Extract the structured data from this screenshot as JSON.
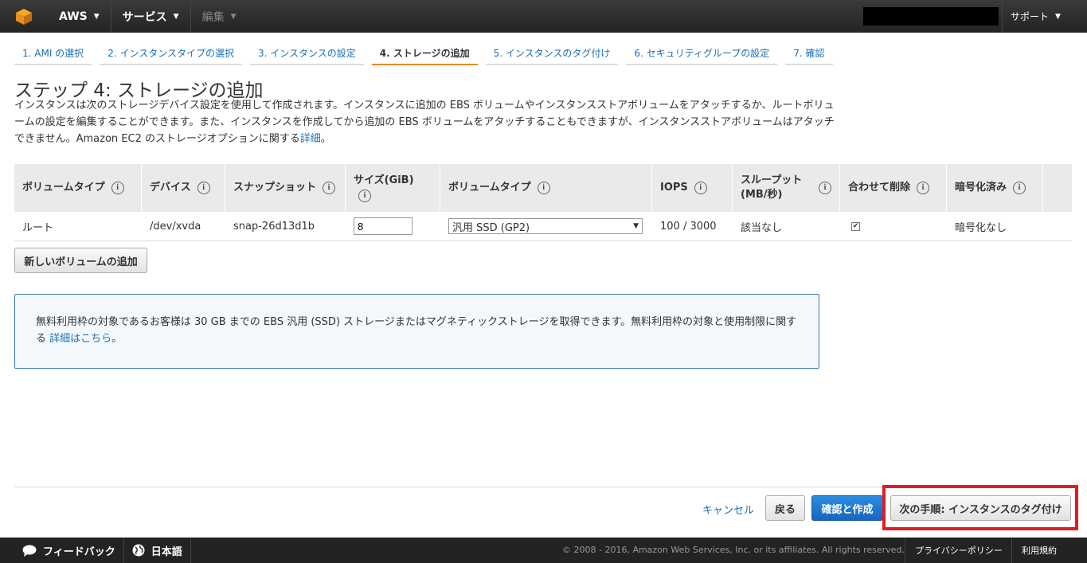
{
  "topnav": {
    "logo_icon": "aws-cube-icon",
    "aws_label": "AWS",
    "services_label": "サービス",
    "edit_label": "編集",
    "support_label": "サポート"
  },
  "wizard": {
    "tabs": [
      {
        "label": "1. AMI の選択",
        "active": false
      },
      {
        "label": "2. インスタンスタイプの選択",
        "active": false
      },
      {
        "label": "3. インスタンスの設定",
        "active": false
      },
      {
        "label": "4. ストレージの追加",
        "active": true
      },
      {
        "label": "5. インスタンスのタグ付け",
        "active": false
      },
      {
        "label": "6. セキュリティグループの設定",
        "active": false
      },
      {
        "label": "7. 確認",
        "active": false
      }
    ]
  },
  "page": {
    "title": "ステップ 4: ストレージの追加",
    "description": "インスタンスは次のストレージデバイス設定を使用して作成されます。インスタンスに追加の EBS ボリュームやインスタンスストアボリュームをアタッチするか、ルートボリュームの設定を編集することができます。また、インスタンスを作成してから追加の EBS ボリュームをアタッチすることもできますが、インスタンスストアボリュームはアタッチできません。Amazon EC2 のストレージオプションに関する",
    "description_link": "詳細",
    "description_end": "。"
  },
  "table": {
    "headers": {
      "volume_type": "ボリュームタイプ",
      "device": "デバイス",
      "snapshot": "スナップショット",
      "size": "サイズ(GiB)",
      "ebs_type": "ボリュームタイプ",
      "iops": "IOPS",
      "throughput": "スループット (MB/秒)",
      "delete": "合わせて削除",
      "encrypted": "暗号化済み"
    },
    "row": {
      "volume_type": "ルート",
      "device": "/dev/xvda",
      "snapshot": "snap-26d13d1b",
      "size": "8",
      "ebs_type": "汎用 SSD (GP2)",
      "iops": "100 / 3000",
      "throughput": "該当なし",
      "delete_checked": true,
      "encrypted": "暗号化なし"
    }
  },
  "add_volume_label": "新しいボリュームの追加",
  "notice": {
    "text": "無料利用枠の対象であるお客様は 30 GB までの EBS 汎用 (SSD) ストレージまたはマグネティックストレージを取得できます。無料利用枠の対象と使用制限に関する",
    "link": "詳細はこちら",
    "end": "。"
  },
  "actions": {
    "cancel": "キャンセル",
    "back": "戻る",
    "review": "確認と作成",
    "next": "次の手順: インスタンスのタグ付け"
  },
  "footer": {
    "feedback": "フィードバック",
    "language": "日本語",
    "copyright": "© 2008 - 2016, Amazon Web Services, Inc. or its affiliates. All rights reserved.",
    "privacy": "プライバシーポリシー",
    "terms": "利用規約"
  },
  "colors": {
    "accent_orange": "#e88c23",
    "link_blue": "#1a6fb3",
    "primary_button": "#1f75d1",
    "highlight_red": "#e41b24"
  }
}
